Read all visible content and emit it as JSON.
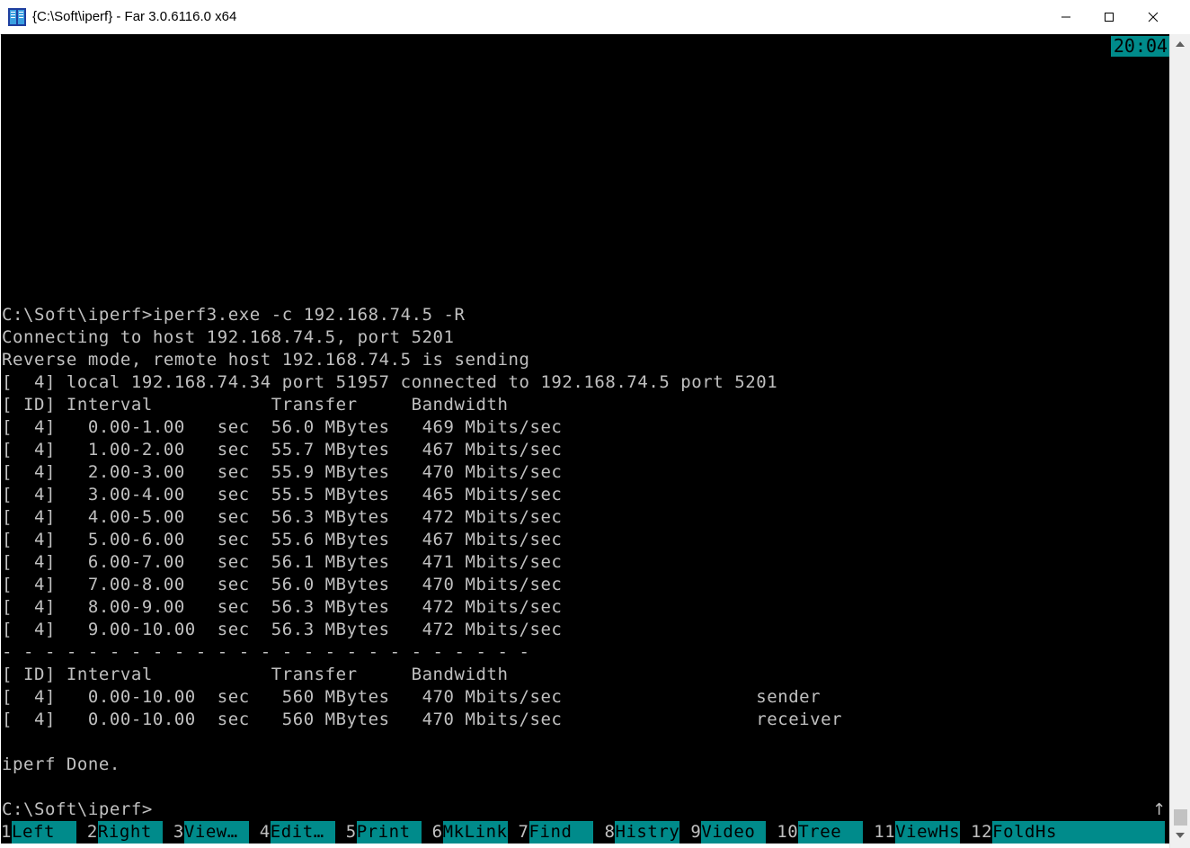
{
  "window": {
    "title": "{C:\\Soft\\iperf} - Far 3.0.6116.0 x64"
  },
  "clock": "20:04",
  "console": {
    "lines": [
      "C:\\Soft\\iperf>iperf3.exe -c 192.168.74.5 -R",
      "Connecting to host 192.168.74.5, port 5201",
      "Reverse mode, remote host 192.168.74.5 is sending",
      "[  4] local 192.168.74.34 port 51957 connected to 192.168.74.5 port 5201",
      "[ ID] Interval           Transfer     Bandwidth",
      "[  4]   0.00-1.00   sec  56.0 MBytes   469 Mbits/sec",
      "[  4]   1.00-2.00   sec  55.7 MBytes   467 Mbits/sec",
      "[  4]   2.00-3.00   sec  55.9 MBytes   470 Mbits/sec",
      "[  4]   3.00-4.00   sec  55.5 MBytes   465 Mbits/sec",
      "[  4]   4.00-5.00   sec  56.3 MBytes   472 Mbits/sec",
      "[  4]   5.00-6.00   sec  55.6 MBytes   467 Mbits/sec",
      "[  4]   6.00-7.00   sec  56.1 MBytes   471 Mbits/sec",
      "[  4]   7.00-8.00   sec  56.0 MBytes   470 Mbits/sec",
      "[  4]   8.00-9.00   sec  56.3 MBytes   472 Mbits/sec",
      "[  4]   9.00-10.00  sec  56.3 MBytes   472 Mbits/sec",
      "- - - - - - - - - - - - - - - - - - - - - - - - -",
      "[ ID] Interval           Transfer     Bandwidth",
      "[  4]   0.00-10.00  sec   560 MBytes   470 Mbits/sec                  sender",
      "[  4]   0.00-10.00  sec   560 MBytes   470 Mbits/sec                  receiver",
      "",
      "iperf Done.",
      "",
      "C:\\Soft\\iperf>"
    ]
  },
  "scroll_indicator": "↑",
  "keybar": [
    {
      "num": "1",
      "label": "Left  "
    },
    {
      "num": " 2",
      "label": "Right "
    },
    {
      "num": " 3",
      "label": "View… "
    },
    {
      "num": " 4",
      "label": "Edit… "
    },
    {
      "num": " 5",
      "label": "Print "
    },
    {
      "num": " 6",
      "label": "MkLink"
    },
    {
      "num": " 7",
      "label": "Find  "
    },
    {
      "num": " 8",
      "label": "Histry"
    },
    {
      "num": " 9",
      "label": "Video "
    },
    {
      "num": " 10",
      "label": "Tree  "
    },
    {
      "num": " 11",
      "label": "ViewHs"
    },
    {
      "num": " 12",
      "label": "FoldHs          "
    }
  ],
  "colors": {
    "console_bg": "#000000",
    "console_fg": "#c0c0c0",
    "accent": "#008b8b"
  }
}
